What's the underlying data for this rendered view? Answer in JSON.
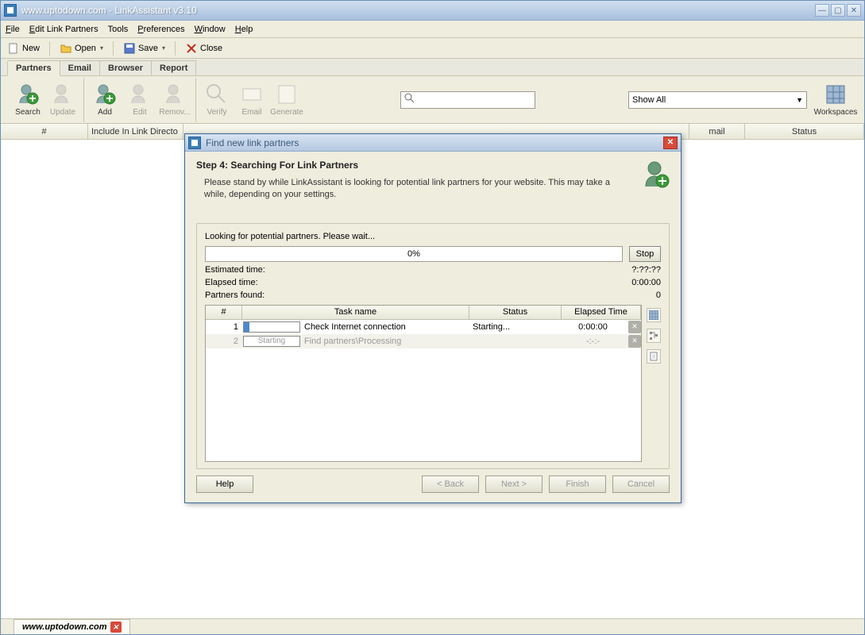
{
  "window": {
    "title": "www.uptodown.com - LinkAssistant v3.10"
  },
  "menu": {
    "file": "File",
    "editPartners": "Edit Link Partners",
    "tools": "Tools",
    "preferences": "Preferences",
    "window": "Window",
    "help": "Help"
  },
  "toolbar": {
    "new": "New",
    "open": "Open",
    "save": "Save",
    "close": "Close"
  },
  "tabs": {
    "partners": "Partners",
    "email": "Email",
    "browser": "Browser",
    "report": "Report"
  },
  "ribbon": {
    "search": "Search",
    "update": "Update",
    "add": "Add",
    "edit": "Edit",
    "remove": "Remov...",
    "verify": "Verify",
    "emailBtn": "Email",
    "generate": "Generate",
    "workspaces": "Workspaces"
  },
  "filter": {
    "showAll": "Show All"
  },
  "columns": {
    "num": "#",
    "include": "Include In Link Directo",
    "email": "mail",
    "status": "Status"
  },
  "dialog": {
    "title": "Find new link partners",
    "stepTitle": "Step 4: Searching For Link Partners",
    "stepDesc": "Please stand by while LinkAssistant is looking for potential link partners for your website. This may take a while, depending on your settings.",
    "looking": "Looking for potential partners. Please wait...",
    "progressPct": "0%",
    "stop": "Stop",
    "estimatedLabel": "Estimated time:",
    "estimatedValue": "?:??:??",
    "elapsedLabel": "Elapsed time:",
    "elapsedValue": "0:00:00",
    "partnersLabel": "Partners found:",
    "partnersValue": "0",
    "taskCols": {
      "num": "#",
      "name": "Task name",
      "status": "Status",
      "elapsed": "Elapsed Time"
    },
    "tasks": [
      {
        "num": "1",
        "name": "Check Internet connection",
        "status": "Starting...",
        "elapsed": "0:00:00",
        "prog": ""
      },
      {
        "num": "2",
        "name": "Find partners\\Processing",
        "status": "",
        "elapsed": "-:-:-",
        "prog": "Starting"
      }
    ],
    "buttons": {
      "help": "Help",
      "back": "< Back",
      "next": "Next >",
      "finish": "Finish",
      "cancel": "Cancel"
    }
  },
  "status": {
    "site": "www.uptodown.com"
  }
}
